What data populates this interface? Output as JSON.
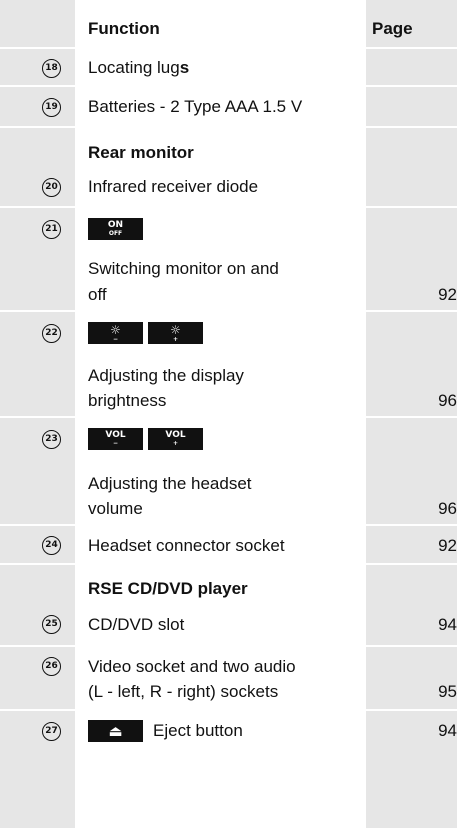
{
  "header": {
    "function": "Function",
    "page": "Page"
  },
  "rows": [
    {
      "num": "18",
      "text": "Locating lug",
      "bold_tail": "s",
      "page": ""
    },
    {
      "num": "19",
      "text": "Batteries - 2 Type AAA 1.5 V",
      "page": ""
    },
    {
      "section": "Rear monitor"
    },
    {
      "num": "20",
      "text": "Infrared receiver diode",
      "page": ""
    },
    {
      "num": "21",
      "key": {
        "top": "ON",
        "bottom": "OFF"
      },
      "text_line1": "Switching monitor on and",
      "text_line2": "off",
      "page": "92"
    },
    {
      "num": "22",
      "keys": [
        {
          "symbol": "☼",
          "sub": "−"
        },
        {
          "symbol": "☼",
          "sub": "+"
        }
      ],
      "text_line1": "Adjusting the display",
      "text_line2": "brightness",
      "page": "96"
    },
    {
      "num": "23",
      "keys": [
        {
          "top": "VOL",
          "sub": "−"
        },
        {
          "top": "VOL",
          "sub": "+"
        }
      ],
      "text_line1": "Adjusting the headset",
      "text_line2": "volume",
      "page": "96"
    },
    {
      "num": "24",
      "text": "Headset connector socket",
      "page": "92"
    },
    {
      "section": "RSE CD/DVD player"
    },
    {
      "num": "25",
      "text": "CD/DVD slot",
      "page": "94"
    },
    {
      "num": "26",
      "text_line1": "Video socket and two audio",
      "text_line2": "(L - left, R - right) sockets",
      "page": "95"
    },
    {
      "num": "27",
      "key": {
        "symbol": "⏏"
      },
      "text": "Eject button",
      "page": "94"
    }
  ],
  "colors": {
    "shade": "#e6e6e6",
    "text": "#111111",
    "key_bg": "#111111",
    "key_fg": "#ffffff"
  }
}
